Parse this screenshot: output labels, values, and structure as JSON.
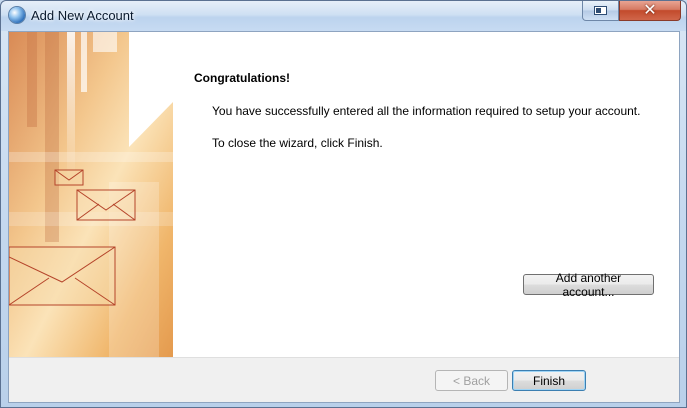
{
  "window": {
    "title": "Add New Account"
  },
  "titlebar": {
    "help_icon": "context-help-icon",
    "close_icon": "close-icon",
    "close_glyph": "✕"
  },
  "content": {
    "heading": "Congratulations!",
    "message_success": "You have successfully entered all the information required to setup your account.",
    "message_close": "To close the wizard, click Finish.",
    "add_another_label": "Add another account..."
  },
  "footer": {
    "back_label": "< Back",
    "finish_label": "Finish"
  },
  "colors": {
    "banner_base": "#f0bf7a",
    "envelope_stroke": "#b5442a",
    "finish_border": "#3c7fb1"
  }
}
